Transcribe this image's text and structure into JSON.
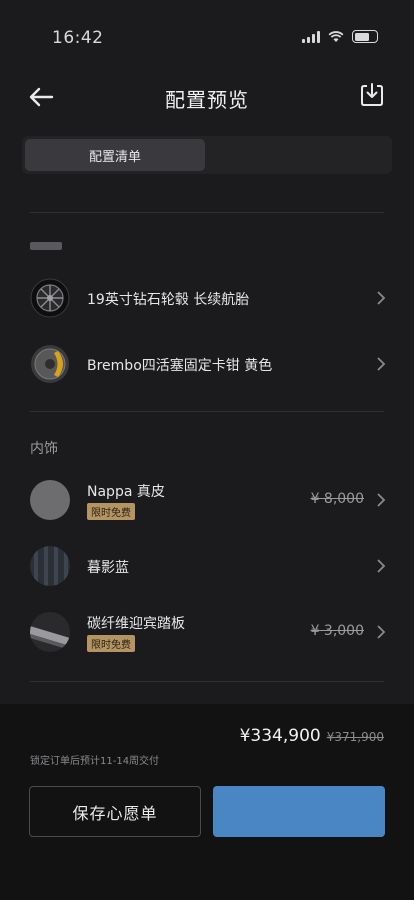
{
  "status_bar": {
    "time": "16:42"
  },
  "nav": {
    "title": "配置预览"
  },
  "segment": {
    "active_label": "配置清单"
  },
  "exterior_items": [
    {
      "label": "19英寸钻石轮毂 长续航胎",
      "icon": "wheel-icon"
    },
    {
      "label": "Brembo四活塞固定卡钳 黄色",
      "icon": "caliper-icon"
    }
  ],
  "interior": {
    "section_title": "内饰",
    "items": [
      {
        "label": "Nappa 真皮",
        "badge": "限时免费",
        "price": "¥ 8,000"
      },
      {
        "label": "暮影蓝",
        "badge": "",
        "price": ""
      },
      {
        "label": "碳纤维迎宾踏板",
        "badge": "限时免费",
        "price": "¥ 3,000"
      }
    ]
  },
  "footer": {
    "total_price": "¥334,900",
    "original_price": "¥371,900",
    "delivery_note": "锁定订单后预计11-14周交付",
    "wishlist_label": "保存心愿单",
    "primary_label": ""
  },
  "colors": {
    "background": "#1b1b1d",
    "badge_gold": "#b49463",
    "primary_blue": "#4b86c4"
  }
}
